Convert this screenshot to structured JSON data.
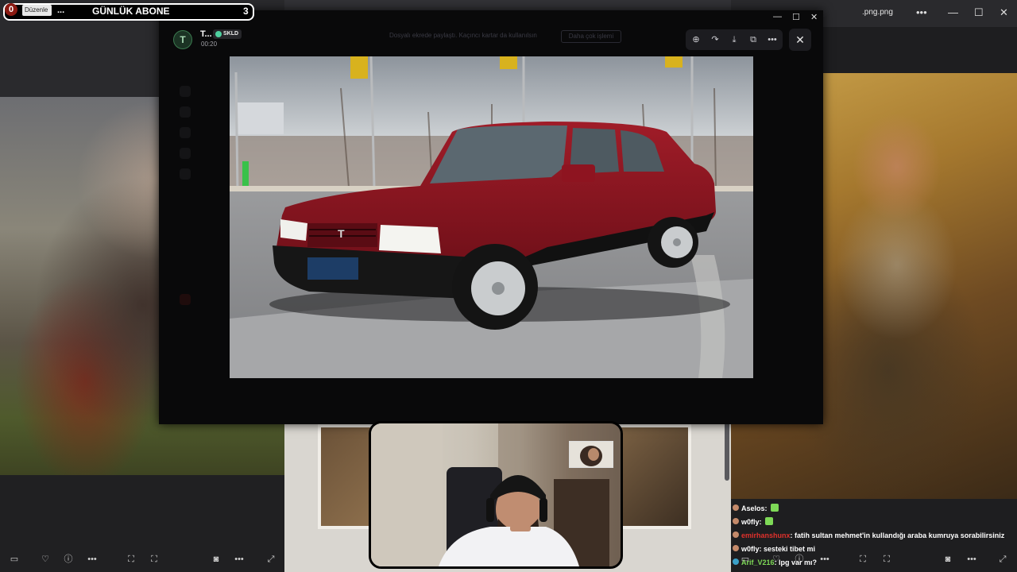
{
  "counter": {
    "left_value": "0",
    "edit_label": "Düzenle",
    "dots": "...",
    "title": "GÜNLÜK ABONE",
    "right_value": "3"
  },
  "right_window": {
    "file_name": ".png.png",
    "more_icon": "more-icon",
    "minimize_icon": "minimize-icon",
    "maximize_icon": "maximize-icon",
    "close_icon": "close-icon"
  },
  "viewer": {
    "sender_initial": "T",
    "sender_name": "T...",
    "badge": "SKLD",
    "time": "00:20",
    "faint_text": "Dosyalı ekrede paylaştı. Kaçıncı kartar da kullanılsın",
    "faint_button": "Daha çok işlemi",
    "tools": [
      "zoom-in-icon",
      "share-icon",
      "download-icon",
      "open-external-icon",
      "more-icon"
    ],
    "close_icon": "close-icon"
  },
  "chat": [
    {
      "user": "Aselos",
      "message": "",
      "emote": true,
      "color": "white"
    },
    {
      "user": "w0fly",
      "message": "",
      "emote": true,
      "color": "white"
    },
    {
      "user": "emirhanshunx",
      "message": "fatih sultan mehmet'in kullandığı araba kumruya sorabilirsiniz",
      "emote": false,
      "color": "red"
    },
    {
      "user": "w0fly",
      "message": "sesteki tibet mi",
      "emote": false,
      "color": "white"
    },
    {
      "user": "Arif_V216",
      "message": "lpg var mı?",
      "emote": false,
      "color": "green"
    }
  ],
  "toolbar_icons": {
    "left": [
      "window-icon",
      "heart-icon",
      "info-icon",
      "more-icon",
      "screenshot-icon",
      "screenshot-icon",
      "camera-icon",
      "more-icon",
      "expand-icon"
    ],
    "right": [
      "window-icon",
      "heart-icon",
      "info-icon",
      "more-icon",
      "screenshot-icon",
      "screenshot-icon",
      "camera-icon",
      "more-icon",
      "expand-icon"
    ]
  },
  "colors": {
    "counter_badge": "#8b1a12",
    "car_body": "#8e1420",
    "chat_red_user": "#e0312c",
    "chat_green_user": "#7ed957",
    "online_badge": "#4fd1a0"
  }
}
